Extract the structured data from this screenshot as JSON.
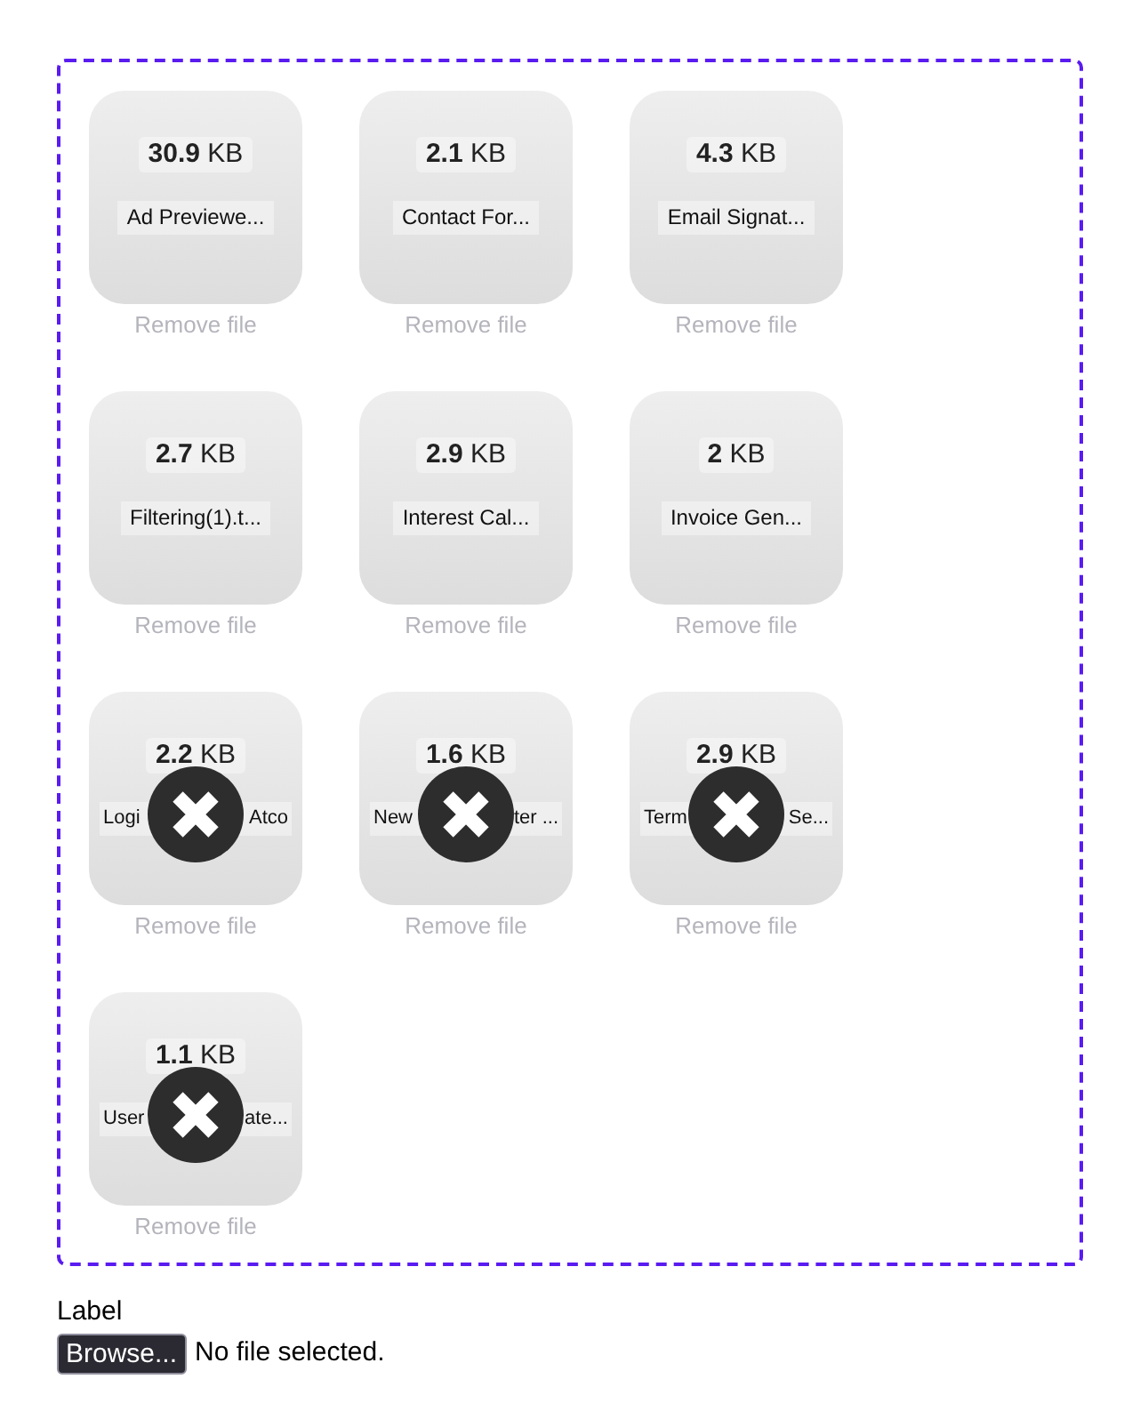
{
  "dropzone": {
    "files": [
      {
        "size": "30.9",
        "unit": "KB",
        "name": "Ad Previewe...",
        "remove": "Remove file",
        "error": false
      },
      {
        "size": "2.1",
        "unit": "KB",
        "name": "Contact For...",
        "remove": "Remove file",
        "error": false
      },
      {
        "size": "4.3",
        "unit": "KB",
        "name": "Email Signat...",
        "remove": "Remove file",
        "error": false
      },
      {
        "size": "2.7",
        "unit": "KB",
        "name": "Filtering(1).t...",
        "remove": "Remove file",
        "error": false
      },
      {
        "size": "2.9",
        "unit": "KB",
        "name": "Interest Cal...",
        "remove": "Remove file",
        "error": false
      },
      {
        "size": "2",
        "unit": "KB",
        "name": "Invoice Gen...",
        "remove": "Remove file",
        "error": false
      },
      {
        "size": "2.2",
        "unit": "KB",
        "name_parts": [
          "Logi",
          "Atco"
        ],
        "remove": "Remove file",
        "error": true
      },
      {
        "size": "1.6",
        "unit": "KB",
        "name_parts": [
          "New",
          "ter ..."
        ],
        "remove": "Remove file",
        "error": true
      },
      {
        "size": "2.9",
        "unit": "KB",
        "name_parts": [
          "Term",
          "Se..."
        ],
        "remove": "Remove file",
        "error": true
      },
      {
        "size": "1.1",
        "unit": "KB",
        "name_parts": [
          "User",
          "ate..."
        ],
        "remove": "Remove file",
        "error": true
      }
    ]
  },
  "field": {
    "label": "Label",
    "button": "Browse...",
    "status": "No file selected."
  }
}
